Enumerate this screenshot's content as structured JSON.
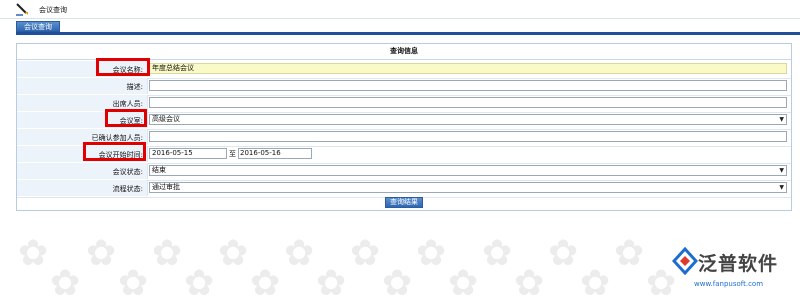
{
  "header": {
    "title": "会议查询"
  },
  "tab": {
    "label": "会议查询"
  },
  "panel": {
    "title": "查询信息"
  },
  "fields": {
    "meeting_name": {
      "label": "会议名称:",
      "value": "年度总结会议"
    },
    "description": {
      "label": "描述:",
      "value": ""
    },
    "attendees": {
      "label": "出席人员:",
      "value": ""
    },
    "meeting_room": {
      "label": "会议室:",
      "value": "高级会议"
    },
    "confirmed_attendees": {
      "label": "已确认参加人员:",
      "value": ""
    },
    "start_time": {
      "label": "会议开始时间:",
      "from": "2016-05-15",
      "to_text": "至",
      "to": "2016-05-16"
    },
    "meeting_status": {
      "label": "会议状态:",
      "value": "结束"
    },
    "process_status": {
      "label": "流程状态:",
      "value": "通过审批"
    }
  },
  "buttons": {
    "query_result": "查询结果"
  },
  "logo": {
    "name": "泛普软件",
    "url": "www.fanpusoft.com"
  },
  "colors": {
    "accent": "#1f4f99",
    "highlight": "#e00000",
    "label_bg": "#edf3fa"
  }
}
